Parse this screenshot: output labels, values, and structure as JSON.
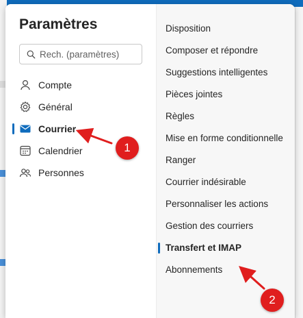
{
  "dialog": {
    "title": "Paramètres",
    "search_placeholder": "Rech. (paramètres)"
  },
  "nav": {
    "items": [
      {
        "label": "Compte",
        "icon": "person-icon",
        "active": false
      },
      {
        "label": "Général",
        "icon": "gear-icon",
        "active": false
      },
      {
        "label": "Courrier",
        "icon": "mail-icon",
        "active": true
      },
      {
        "label": "Calendrier",
        "icon": "calendar-icon",
        "active": false
      },
      {
        "label": "Personnes",
        "icon": "people-icon",
        "active": false
      }
    ]
  },
  "submenu": {
    "items": [
      "Disposition",
      "Composer et répondre",
      "Suggestions intelligentes",
      "Pièces jointes",
      "Règles",
      "Mise en forme conditionnelle",
      "Ranger",
      "Courrier indésirable",
      "Personnaliser les actions",
      "Gestion des courriers",
      "Transfert et IMAP",
      "Abonnements"
    ],
    "active_item": "Transfert et IMAP"
  },
  "annotations": {
    "step1": "1",
    "step2": "2",
    "color": "#e01e1e"
  },
  "colors": {
    "accent": "#0f6cbd",
    "annotation_red": "#e01e1e"
  }
}
